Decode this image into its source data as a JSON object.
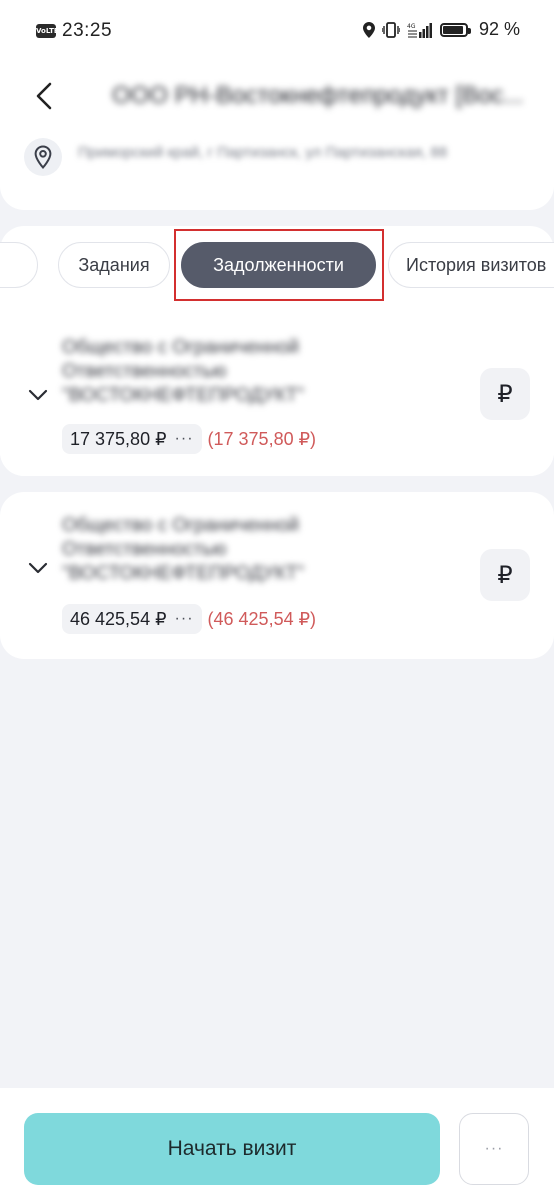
{
  "status_bar": {
    "network_badge": "VoLTE",
    "time": "23:25",
    "battery_level": 0.92,
    "battery_pct": "92 %"
  },
  "header": {
    "title": "ООО РН-Востокнефтепродукт [Вос...",
    "address": "Приморский край, г Партизанск, ул Партизанская, 88"
  },
  "tabs": [
    {
      "label": ""
    },
    {
      "label": "Задания"
    },
    {
      "label": "Задолженности",
      "active": true
    },
    {
      "label": "История визитов"
    }
  ],
  "debts": [
    {
      "org_name": "Общество с Ограниченной Ответственностью \"ВОСТОКНЕФТЕПРОДУКТ\"",
      "amount": "17 375,80 ₽",
      "more": "···",
      "overdue": "(17 375,80 ₽)",
      "pay_symbol": "₽"
    },
    {
      "org_name": "Общество с Ограниченной Ответственностью \"ВОСТОКНЕФТЕПРОДУКТ\"",
      "amount": "46 425,54 ₽",
      "more": "···",
      "overdue": "(46 425,54 ₽)",
      "pay_symbol": "₽"
    }
  ],
  "footer": {
    "start_visit": "Начать визит",
    "more": "···"
  },
  "colors": {
    "accent": "#7fd9dc",
    "active_tab": "#565b6a",
    "overdue": "#d05a5a",
    "highlight": "#d32f2f"
  }
}
